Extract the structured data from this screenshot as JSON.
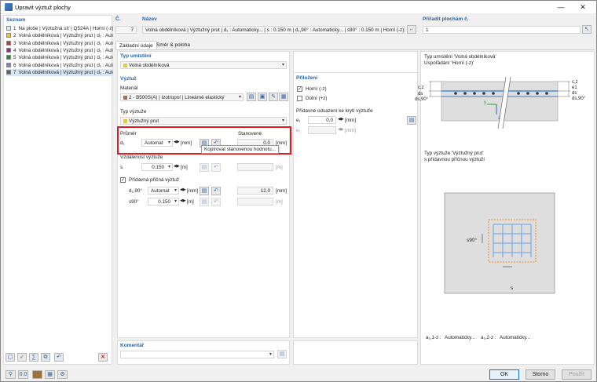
{
  "window": {
    "title": "Upravit výztuž plochy"
  },
  "list": {
    "header": "Seznam",
    "items": [
      {
        "no": "1",
        "label": "Na ploše | Výztužná síť | Q524A | Horní (-z) | Da",
        "color": "#d8eff7"
      },
      {
        "no": "2",
        "label": "Volná obdélníková | Výztužný prut | d₁ : Auto",
        "color": "#f4c430"
      },
      {
        "no": "3",
        "label": "Volná obdélníková | Výztužný prut | d₁ : Auto",
        "color": "#b04040"
      },
      {
        "no": "4",
        "label": "Volná obdélníková | Výztužný prut | d₁ : Auto",
        "color": "#8a2f8f"
      },
      {
        "no": "5",
        "label": "Volná obdélníková | Výztužný prut | d₁ : Auto",
        "color": "#2a8a2a"
      },
      {
        "no": "6",
        "label": "Volná obdélníková | Výztužný prut | d₁ : Auto",
        "color": "#8080c8"
      },
      {
        "no": "7",
        "label": "Volná obdélníková | Výztužný prut | d₁ : Auto",
        "color": "#606060"
      }
    ],
    "selected_index": 6
  },
  "header": {
    "no_label": "Č.",
    "no_value": "7",
    "name_label": "Název",
    "name_value": "Volná obdélníková | Výztužný prut | d₁ : Automaticky... | s : 0.150 m | d₁,90° : Automaticky... | s90° : 0.150 m | Horní (-z) (Plochy : 1)",
    "assign_label": "Přiřadit plochám č.",
    "assign_value": "1"
  },
  "tabs": [
    {
      "label": "Základní údaje",
      "active": true
    },
    {
      "label": "Směr & poloha",
      "active": false
    }
  ],
  "basic": {
    "placement_type_label": "Typ umístění",
    "placement_type_value": "Volná obdélníková",
    "reinforcement_label": "Výztuž",
    "material_label": "Materiál",
    "material_value": "2 - B500S(A) | Izotropní | Lineárně elastický",
    "rebar_type_label": "Typ výztuže",
    "rebar_type_value": "Výztužný prut",
    "diameter_label": "Průměr",
    "determined_label": "Stanovené",
    "d1_label": "d₁",
    "d1_value": "Automat",
    "unit_mm": "[mm]",
    "unit_m": "[m]",
    "d1_determined": "0.0",
    "tooltip": "Kopírovat stanovenou hodnotu...",
    "spacing_label": "Vzdálenost výztuže",
    "s_label": "s",
    "s_value": "0.150",
    "additional_label": "Přídavná příčná výztuž",
    "d190_label": "d₁,90°",
    "d190_value": "Automat",
    "d190_determined": "12.0",
    "s90_label": "s90°",
    "s90_value": "0.150",
    "comment_label": "Komentář"
  },
  "cover": {
    "label": "Přiložení",
    "top_label": "Horní (-z)",
    "top_checked": true,
    "bottom_label": "Dolní (+z)",
    "bottom_checked": false,
    "extra_label": "Přídavné odsazení ke krytí výztuže",
    "e1_label": "e₁",
    "e1_value": "0.0",
    "e2_label": "e₂",
    "unit_mm": "[mm]"
  },
  "preview": {
    "title1": "Typ umístění 'Volná obdélníková'",
    "title1b": "Uspořádání 'Horní (-z)'",
    "title2": "Typ výztuže 'Výztužný prut'",
    "title2b": "s přídavnou příčnou výztuží",
    "lbl_cz": "c,z",
    "lbl_ds": "ds",
    "lbl_ds90": "ds,90°",
    "lbl_cz_r": "c,z",
    "lbl_e1": "e1",
    "lbl_ds_r": "ds",
    "lbl_ds90_r": "ds,90°",
    "lbl_y": "y",
    "lbl_z": "z",
    "lbl_s90": "s90°",
    "lbl_s": "s",
    "foot1_label": "a₁,1-z :",
    "foot1_value": "Automaticky...",
    "foot2_label": "a₁,2-z :",
    "foot2_value": "Automaticky..."
  },
  "buttons": {
    "ok": "OK",
    "cancel": "Storno",
    "apply": "Použít"
  },
  "colors": {
    "accent": "#2a62a8",
    "highlight": "#e01b24",
    "rebar_orange": "#f08a24",
    "grid_blue": "#6aa0e0"
  }
}
